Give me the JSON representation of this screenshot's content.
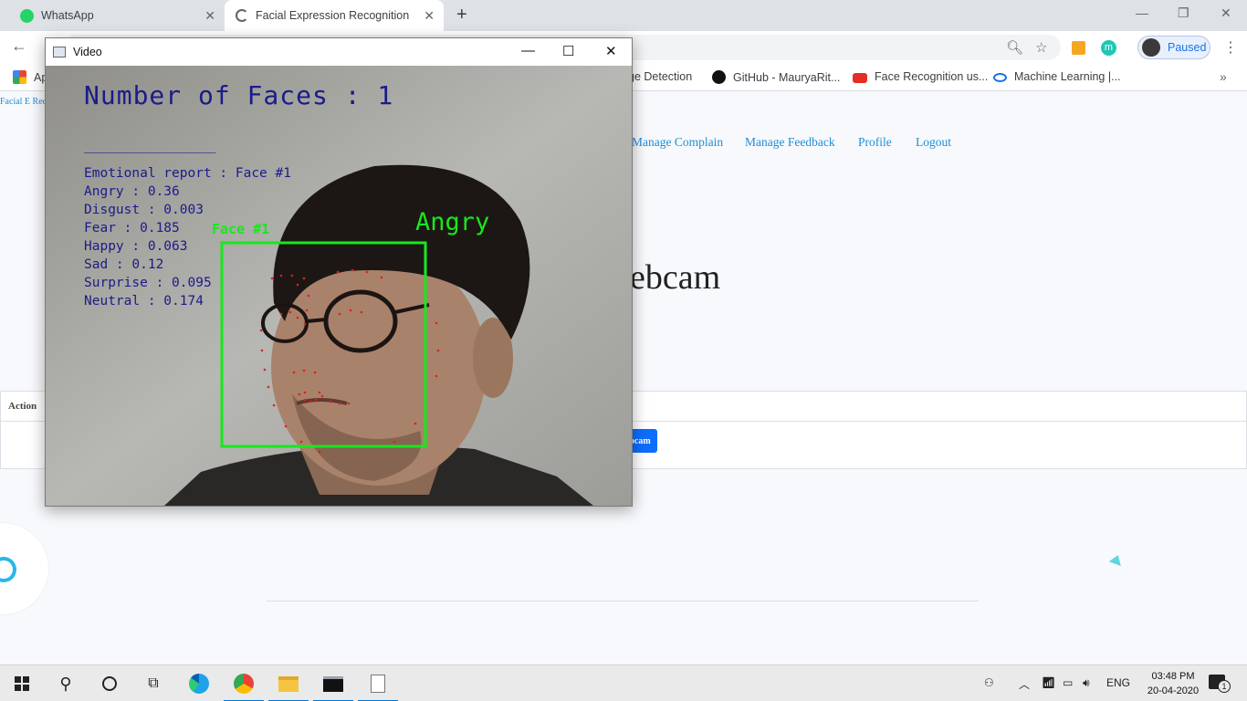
{
  "browser": {
    "tabs": [
      {
        "label": "WhatsApp"
      },
      {
        "label": "Facial Expression Recognition"
      }
    ],
    "profile_label": "Paused",
    "bookmarks": [
      {
        "label": "Ap"
      },
      {
        "label": "ge Detection"
      },
      {
        "label": "GitHub - MauryaRit..."
      },
      {
        "label": "Face Recognition us..."
      },
      {
        "label": "Machine Learning |..."
      }
    ]
  },
  "page": {
    "logo_alt": "Facial E Recognitio",
    "nav": [
      {
        "label": "Manage Complain"
      },
      {
        "label": "Manage Feedback"
      },
      {
        "label": "Profile"
      },
      {
        "label": "Logout"
      }
    ],
    "heading_fragment": "ebcam",
    "table_header": "Action",
    "button_fragment": "bcam"
  },
  "video_window": {
    "title": "Video",
    "faces_text": "Number of Faces : 1",
    "divider": "________________",
    "report_title": "Emotional report : Face #1",
    "emotions": [
      {
        "label": "Angry : 0.36"
      },
      {
        "label": "Disgust : 0.003"
      },
      {
        "label": "Fear : 0.185"
      },
      {
        "label": "Happy : 0.063"
      },
      {
        "label": "Sad : 0.12"
      },
      {
        "label": "Surprise : 0.095"
      },
      {
        "label": "Neutral : 0.174"
      }
    ],
    "face_label": "Face #1",
    "emotion_label": "Angry",
    "colors": {
      "overlay_text": "#1b1b8a",
      "face_box": "#17e81d",
      "landmark": "#e0201c"
    }
  },
  "taskbar": {
    "language": "ENG",
    "time": "03:48 PM",
    "date": "20-04-2020",
    "notification_count": "1"
  }
}
